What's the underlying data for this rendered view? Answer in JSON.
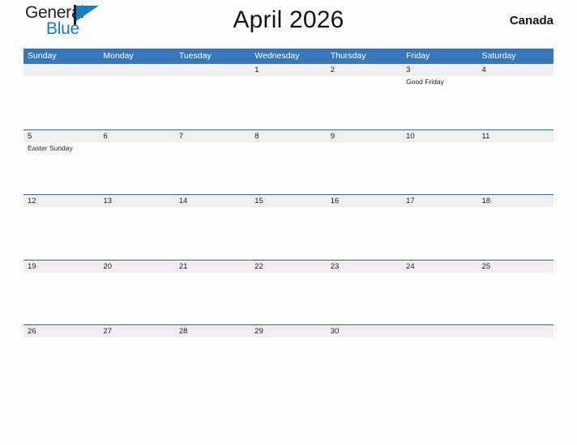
{
  "brand": {
    "name_part1": "General",
    "name_part2": "Blue",
    "flag_icon": "flag-icon",
    "accent_color": "#1f7bc1"
  },
  "header": {
    "title": "April 2026",
    "region": "Canada"
  },
  "colors": {
    "header_blue": "#3a77b8",
    "row_divider_blue": "#2c6ca3",
    "date_band_gray": "#efefef",
    "page_background": "#fdfdfd",
    "text_dark": "#222222"
  },
  "calendar": {
    "weekdays": [
      "Sunday",
      "Monday",
      "Tuesday",
      "Wednesday",
      "Thursday",
      "Friday",
      "Saturday"
    ],
    "weeks": [
      [
        {
          "day": "",
          "event": ""
        },
        {
          "day": "",
          "event": ""
        },
        {
          "day": "",
          "event": ""
        },
        {
          "day": "1",
          "event": ""
        },
        {
          "day": "2",
          "event": ""
        },
        {
          "day": "3",
          "event": "Good Friday"
        },
        {
          "day": "4",
          "event": ""
        }
      ],
      [
        {
          "day": "5",
          "event": "Easter Sunday"
        },
        {
          "day": "6",
          "event": ""
        },
        {
          "day": "7",
          "event": ""
        },
        {
          "day": "8",
          "event": ""
        },
        {
          "day": "9",
          "event": ""
        },
        {
          "day": "10",
          "event": ""
        },
        {
          "day": "11",
          "event": ""
        }
      ],
      [
        {
          "day": "12",
          "event": ""
        },
        {
          "day": "13",
          "event": ""
        },
        {
          "day": "14",
          "event": ""
        },
        {
          "day": "15",
          "event": ""
        },
        {
          "day": "16",
          "event": ""
        },
        {
          "day": "17",
          "event": ""
        },
        {
          "day": "18",
          "event": ""
        }
      ],
      [
        {
          "day": "19",
          "event": ""
        },
        {
          "day": "20",
          "event": ""
        },
        {
          "day": "21",
          "event": ""
        },
        {
          "day": "22",
          "event": ""
        },
        {
          "day": "23",
          "event": ""
        },
        {
          "day": "24",
          "event": ""
        },
        {
          "day": "25",
          "event": ""
        }
      ],
      [
        {
          "day": "26",
          "event": ""
        },
        {
          "day": "27",
          "event": ""
        },
        {
          "day": "28",
          "event": ""
        },
        {
          "day": "29",
          "event": ""
        },
        {
          "day": "30",
          "event": ""
        },
        {
          "day": "",
          "event": ""
        },
        {
          "day": "",
          "event": ""
        }
      ]
    ]
  }
}
